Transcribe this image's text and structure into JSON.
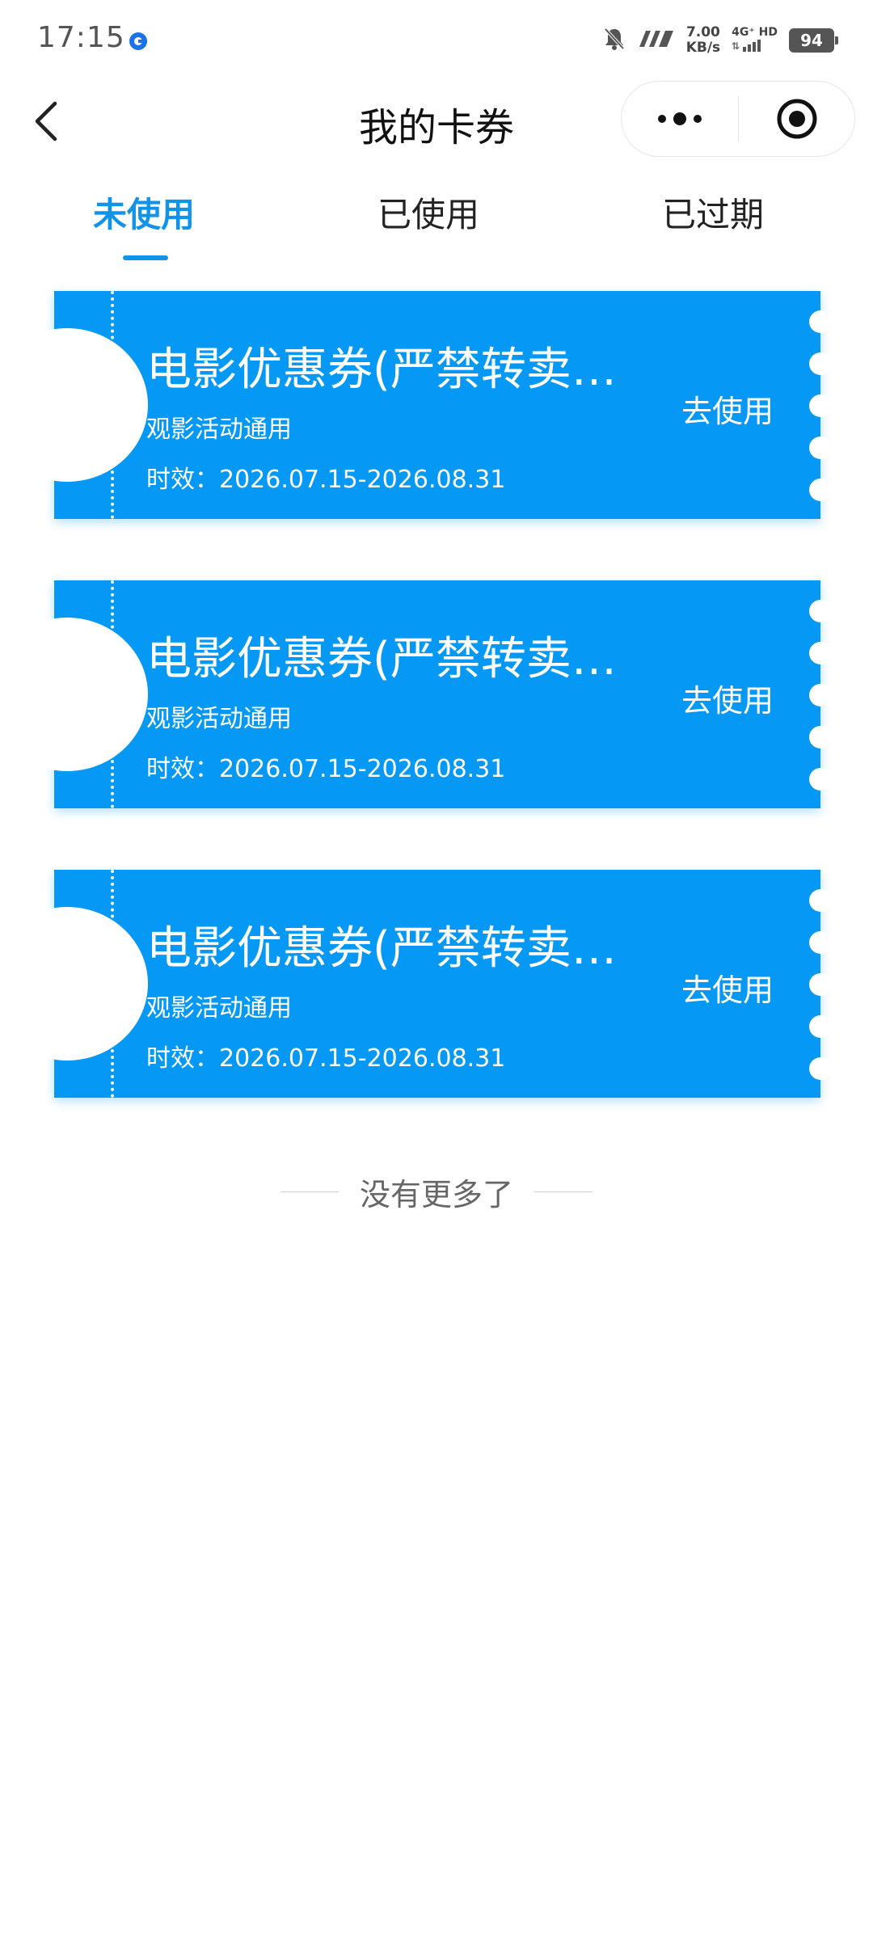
{
  "status_bar": {
    "time": "17:15",
    "speed_value": "7.00",
    "speed_unit": "KB/s",
    "network": "4G⁺ HD",
    "battery": "94"
  },
  "nav": {
    "title": "我的卡券"
  },
  "tabs": [
    {
      "label": "未使用",
      "active": true
    },
    {
      "label": "已使用",
      "active": false
    },
    {
      "label": "已过期",
      "active": false
    }
  ],
  "coupons": [
    {
      "title": "电影优惠券(严禁转卖…",
      "subtitle": "观影活动通用",
      "validity": "时效：2026.07.15-2026.08.31",
      "action": "去使用"
    },
    {
      "title": "电影优惠券(严禁转卖…",
      "subtitle": "观影活动通用",
      "validity": "时效：2026.07.15-2026.08.31",
      "action": "去使用"
    },
    {
      "title": "电影优惠券(严禁转卖…",
      "subtitle": "观影活动通用",
      "validity": "时效：2026.07.15-2026.08.31",
      "action": "去使用"
    }
  ],
  "footer": {
    "text": "没有更多了"
  },
  "colors": {
    "accent": "#1093e8",
    "coupon_bg": "#0599f5"
  }
}
